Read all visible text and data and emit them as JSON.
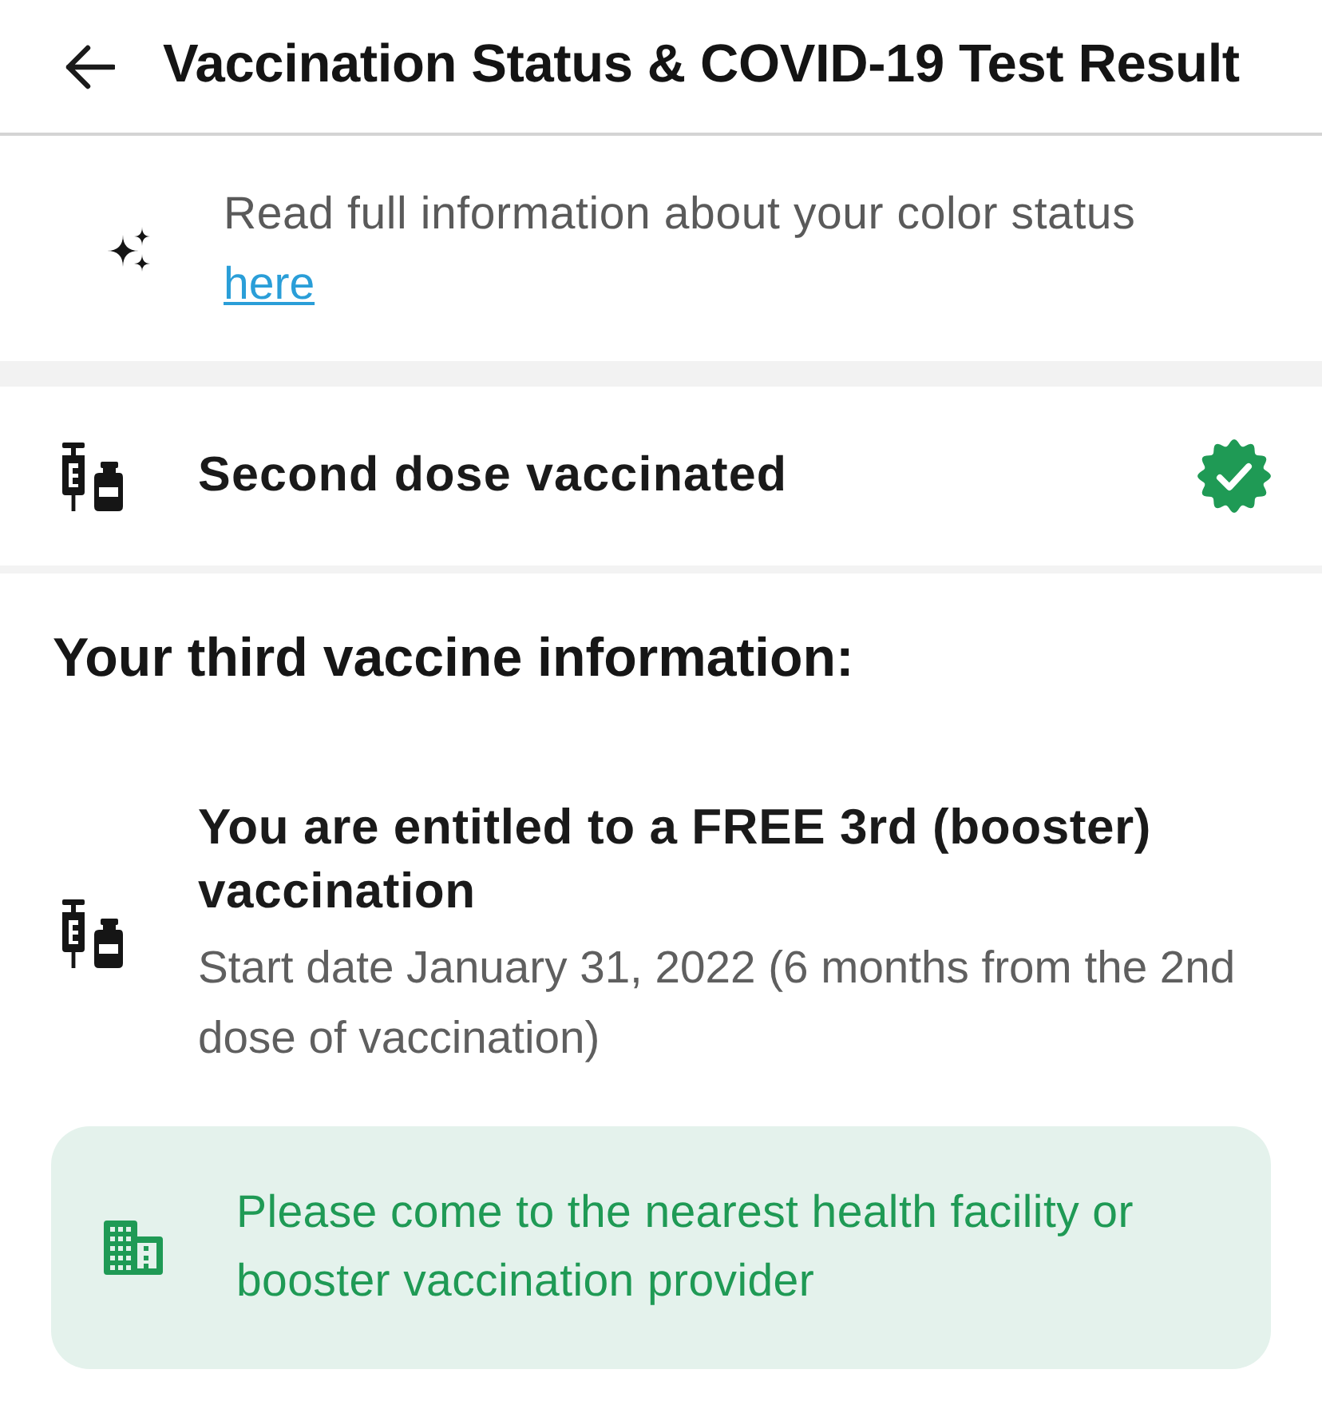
{
  "header": {
    "title": "Vaccination Status & COVID-19 Test Result"
  },
  "info": {
    "text": "Read full information about your color status",
    "link": "here"
  },
  "status": {
    "label": "Second dose vaccinated",
    "verified": true
  },
  "section_title": "Your third vaccine information:",
  "booster": {
    "title": "You are entitled to a FREE 3rd (booster) vaccination",
    "detail": "Start date January 31, 2022 (6 months from the 2nd dose of vaccination)"
  },
  "notice": {
    "text": "Please come to the nearest health facility or booster vaccination provider"
  }
}
